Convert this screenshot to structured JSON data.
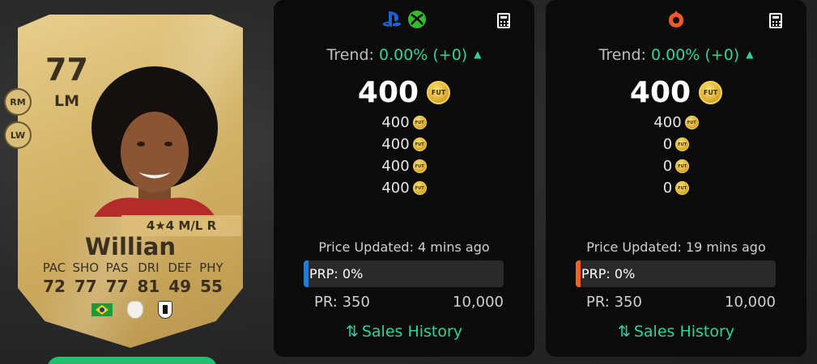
{
  "player": {
    "rating": "77",
    "position": "LM",
    "alt_positions": [
      "RM",
      "LW"
    ],
    "skills": "4★4 M/L R",
    "name": "Willian",
    "stats": [
      {
        "label": "PAC",
        "value": "72"
      },
      {
        "label": "SHO",
        "value": "77"
      },
      {
        "label": "PAS",
        "value": "77"
      },
      {
        "label": "DRI",
        "value": "81"
      },
      {
        "label": "DEF",
        "value": "49"
      },
      {
        "label": "PHY",
        "value": "55"
      }
    ],
    "nation_icon": "brazil-flag-icon",
    "league_icon": "premier-league-icon",
    "club_icon": "fulham-crest-icon"
  },
  "panels": [
    {
      "platform_icons": [
        "playstation-icon",
        "xbox-icon"
      ],
      "trend_label": "Trend:",
      "trend_value": "0.00% (+0)",
      "main_price": "400",
      "prices": [
        "400",
        "400",
        "400",
        "400"
      ],
      "updated": "Price Updated: 4 mins ago",
      "prp": "PRP: 0%",
      "prp_value": 0,
      "prp_color": "#1e7de0",
      "pr_min": "PR: 350",
      "pr_max": "10,000",
      "sales_label": "Sales History"
    },
    {
      "platform_icons": [
        "origin-icon"
      ],
      "trend_label": "Trend:",
      "trend_value": "0.00% (+0)",
      "main_price": "400",
      "prices": [
        "400",
        "0",
        "0",
        "0"
      ],
      "updated": "Price Updated: 19 mins ago",
      "prp": "PRP: 0%",
      "prp_value": 0,
      "prp_color": "#e8661d",
      "pr_min": "PR: 350",
      "pr_max": "10,000",
      "sales_label": "Sales History"
    }
  ],
  "coin_text": "FUT",
  "colors": {
    "accent_green": "#2ed3a0",
    "panel_bg": "#0b0b0b",
    "card_gold": "#d7b86d"
  }
}
